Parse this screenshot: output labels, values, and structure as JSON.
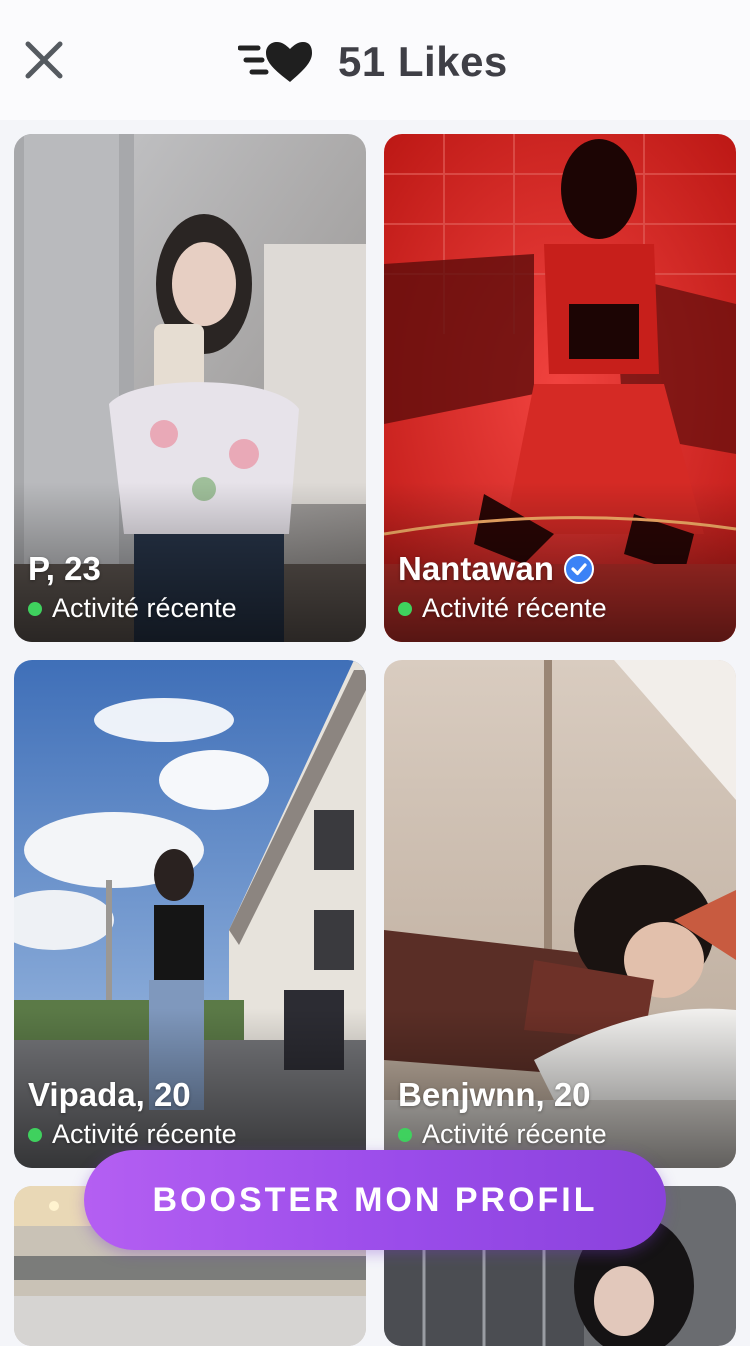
{
  "header": {
    "close_icon": "close-icon",
    "likes_icon": "likes-heart-icon",
    "title": "51 Likes"
  },
  "cards": [
    {
      "name": "P, 23",
      "verified": false,
      "status": "Activité récente"
    },
    {
      "name": "Nantawan",
      "verified": true,
      "status": "Activité récente"
    },
    {
      "name": "Vipada, 20",
      "verified": false,
      "status": "Activité récente"
    },
    {
      "name": "Benjwnn, 20",
      "verified": false,
      "status": "Activité récente"
    }
  ],
  "boost_button": {
    "label": "BOOSTER MON PROFIL"
  },
  "colors": {
    "accent_purple": "#9a4cea",
    "activity_green": "#3fd15e",
    "verified_blue": "#3b82f6"
  }
}
